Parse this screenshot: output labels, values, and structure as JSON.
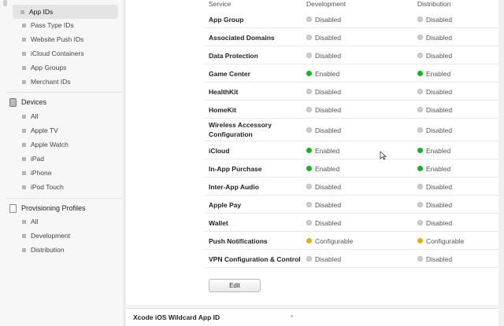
{
  "sidebar": {
    "identifiers": [
      {
        "label": "App IDs",
        "active": true
      },
      {
        "label": "Pass Type IDs"
      },
      {
        "label": "Website Push IDs"
      },
      {
        "label": "iCloud Containers"
      },
      {
        "label": "App Groups"
      },
      {
        "label": "Merchant IDs"
      }
    ],
    "devices": {
      "title": "Devices",
      "items": [
        "All",
        "Apple TV",
        "Apple Watch",
        "iPad",
        "iPhone",
        "iPod Touch"
      ]
    },
    "profiles": {
      "title": "Provisioning Profiles",
      "items": [
        "All",
        "Development",
        "Distribution"
      ]
    }
  },
  "table": {
    "headers": {
      "service": "Service",
      "development": "Development",
      "distribution": "Distribution"
    },
    "rows": [
      {
        "service": "App Group",
        "dev": "Disabled",
        "dev_state": "disabled",
        "dist": "Disabled",
        "dist_state": "disabled"
      },
      {
        "service": "Associated Domains",
        "dev": "Disabled",
        "dev_state": "disabled",
        "dist": "Disabled",
        "dist_state": "disabled"
      },
      {
        "service": "Data Protection",
        "dev": "Disabled",
        "dev_state": "disabled",
        "dist": "Disabled",
        "dist_state": "disabled"
      },
      {
        "service": "Game Center",
        "dev": "Enabled",
        "dev_state": "enabled",
        "dist": "Enabled",
        "dist_state": "enabled"
      },
      {
        "service": "HealthKit",
        "dev": "Disabled",
        "dev_state": "disabled",
        "dist": "Disabled",
        "dist_state": "disabled"
      },
      {
        "service": "HomeKit",
        "dev": "Disabled",
        "dev_state": "disabled",
        "dist": "Disabled",
        "dist_state": "disabled"
      },
      {
        "service": "Wireless Accessory Configuration",
        "dev": "Disabled",
        "dev_state": "disabled",
        "dist": "Disabled",
        "dist_state": "disabled"
      },
      {
        "service": "iCloud",
        "dev": "Enabled",
        "dev_state": "enabled",
        "dist": "Enabled",
        "dist_state": "enabled"
      },
      {
        "service": "In-App Purchase",
        "dev": "Enabled",
        "dev_state": "enabled",
        "dist": "Enabled",
        "dist_state": "enabled"
      },
      {
        "service": "Inter-App Audio",
        "dev": "Disabled",
        "dev_state": "disabled",
        "dist": "Disabled",
        "dist_state": "disabled"
      },
      {
        "service": "Apple Pay",
        "dev": "Disabled",
        "dev_state": "disabled",
        "dist": "Disabled",
        "dist_state": "disabled"
      },
      {
        "service": "Wallet",
        "dev": "Disabled",
        "dev_state": "disabled",
        "dist": "Disabled",
        "dist_state": "disabled"
      },
      {
        "service": "Push Notifications",
        "dev": "Configurable",
        "dev_state": "configurable",
        "dist": "Configurable",
        "dist_state": "configurable"
      },
      {
        "service": "VPN Configuration & Control",
        "dev": "Disabled",
        "dev_state": "disabled",
        "dist": "Disabled",
        "dist_state": "disabled"
      }
    ],
    "edit_label": "Edit"
  },
  "footer": {
    "label": "Xcode iOS Wildcard App ID",
    "value": "*"
  },
  "colors": {
    "enabled": "#1ab02a",
    "configurable": "#e6ac1c",
    "disabled": "#cfcfcf"
  }
}
